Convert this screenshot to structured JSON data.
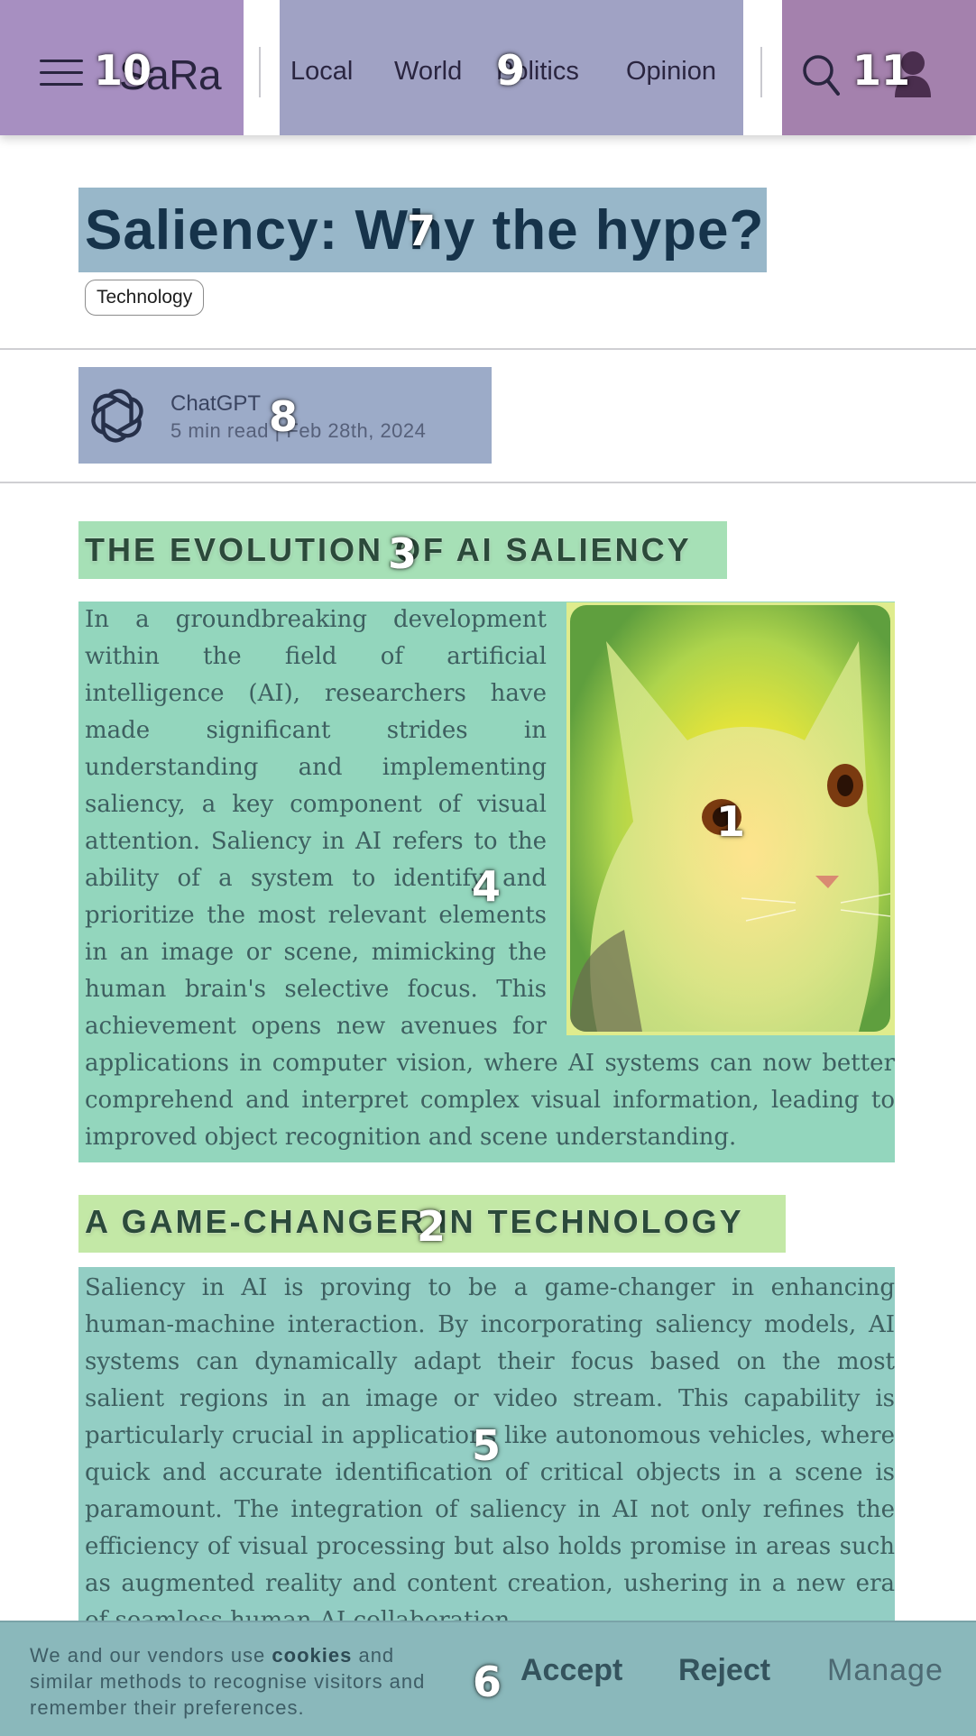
{
  "header": {
    "logo": "SaRa",
    "nav": [
      "Local",
      "World",
      "Politics",
      "Opinion"
    ]
  },
  "article": {
    "title": "Saliency: Why the hype?",
    "tag": "Technology",
    "author": {
      "name": "ChatGPT",
      "meta": "5 min read | Feb 28th, 2024"
    },
    "sections": [
      {
        "heading": "THE EVOLUTION OF AI SALIENCY",
        "body": "In a groundbreaking development within the field of artificial intelligence (AI), researchers have made significant strides in understanding and implementing saliency, a key component of visual attention. Saliency in AI refers to the ability of a system to identify and prioritize the most relevant elements in an image or scene, mimicking the human brain's selective focus. This achievement opens new avenues for applications in computer vision, where AI systems can now better comprehend and interpret complex visual information, leading to improved object recognition and scene understanding."
      },
      {
        "heading_prefix": "A ",
        "heading_strong": "GAME-CHANGER",
        "heading_suffix": " IN TECHNOLOGY",
        "body": "Saliency in AI is proving to be a game-changer in enhancing human-machine interaction. By incorporating saliency models, AI systems can dynamically adapt their focus based on the most salient regions in an image or video stream. This capability is particularly crucial in applications like autonomous vehicles, where quick and accurate identification of critical objects in a scene is paramount. The integration of saliency in AI not only refines the efficiency of visual processing but also holds promise in areas such as augmented reality and content creation, ushering in a new era of seamless human-AI collaboration."
      }
    ]
  },
  "cookie": {
    "text_before": "We and our vendors use ",
    "text_strong": "cookies",
    "text_after": " and similar methods to recognise visitors and remember their preferences.",
    "accept": "Accept",
    "reject": "Reject",
    "manage": "Manage"
  },
  "markers": [
    "1",
    "2",
    "3",
    "4",
    "5",
    "6",
    "7",
    "8",
    "9",
    "10",
    "11"
  ],
  "colors": {
    "image_region": "#dfec8d",
    "heading_region": "#a6e0b6",
    "paragraph_region": "#93d6bd",
    "title_region": "#98b7c9",
    "author_region": "#9cabc8",
    "nav_region": "#a0a2c4",
    "logo_region": "#a78fc1",
    "tools_region": "#a481ad",
    "cookie_region": "#8ab8bb"
  },
  "icons": [
    "hamburger-icon",
    "search-icon",
    "user-icon",
    "openai-logo-icon",
    "cat-photo"
  ]
}
